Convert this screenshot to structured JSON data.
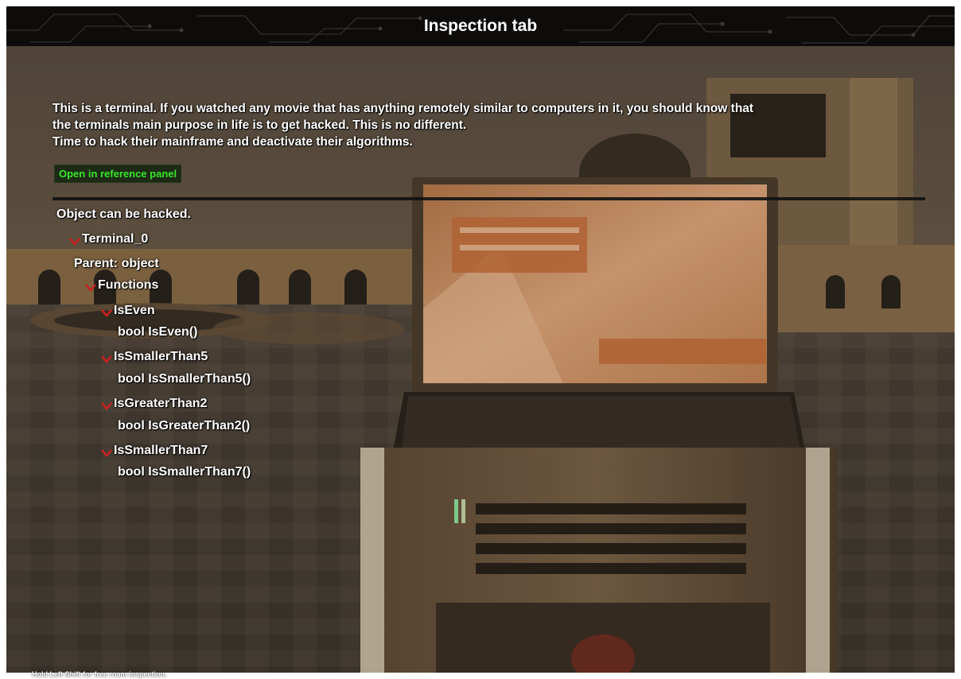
{
  "title": "Inspection tab",
  "description": [
    "This is a terminal. If you watched any movie that has anything remotely similar to computers in it, you should know that",
    "the terminals main purpose in life is to get hacked. This is no different.",
    "Time to hack their mainframe and deactivate their algorithms."
  ],
  "reference_button": "Open in reference panel",
  "status": "Object can be hacked.",
  "tree": {
    "object_name": "Terminal_0",
    "parent": "Parent: object",
    "functions_label": "Functions",
    "functions": [
      {
        "name": "IsEven",
        "signature": "bool IsEven()"
      },
      {
        "name": "IsSmallerThan5",
        "signature": "bool IsSmallerThan5()"
      },
      {
        "name": "IsGreaterThan2",
        "signature": "bool IsGreaterThan2()"
      },
      {
        "name": "IsSmallerThan7",
        "signature": "bool IsSmallerThan7()"
      }
    ]
  },
  "hint": "Hold Left Shift for free roam inspection.",
  "colors": {
    "title_bar": "#0e0c0b",
    "button_text": "#38e62a",
    "button_bg": "#1d2a15",
    "arrow": "#cc1f1f"
  },
  "icons": [
    "expand-arrow-icon"
  ]
}
